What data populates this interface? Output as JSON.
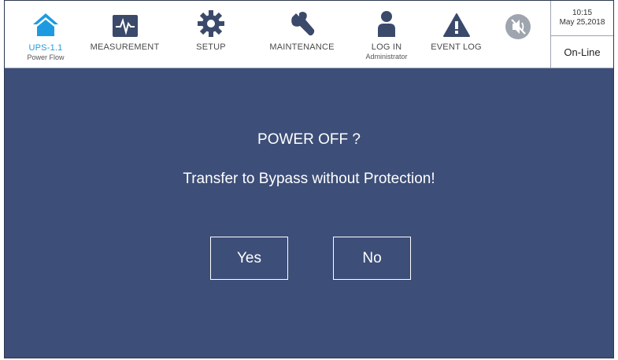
{
  "nav": {
    "home_label": "UPS-1.1",
    "home_sub": "Power Flow",
    "measurement_label": "MEASUREMENT",
    "setup_label": "SETUP",
    "maintenance_label": "MAINTENANCE",
    "login_label": "LOG IN",
    "login_sub": "Administrator",
    "eventlog_label": "EVENT LOG"
  },
  "clock": {
    "time": "10:15",
    "date": "May 25,2018"
  },
  "status": "On-Line",
  "dialog": {
    "title": "POWER OFF ?",
    "message": "Transfer to Bypass without Protection!",
    "yes_label": "Yes",
    "no_label": "No"
  },
  "colors": {
    "accent": "#1e9be0",
    "icon_dark": "#3b4a6b",
    "dialog_bg": "#3d4e78"
  },
  "icons": [
    "home-icon",
    "waveform-icon",
    "gear-icon",
    "wrench-icon",
    "user-icon",
    "warning-icon",
    "mute-icon"
  ]
}
